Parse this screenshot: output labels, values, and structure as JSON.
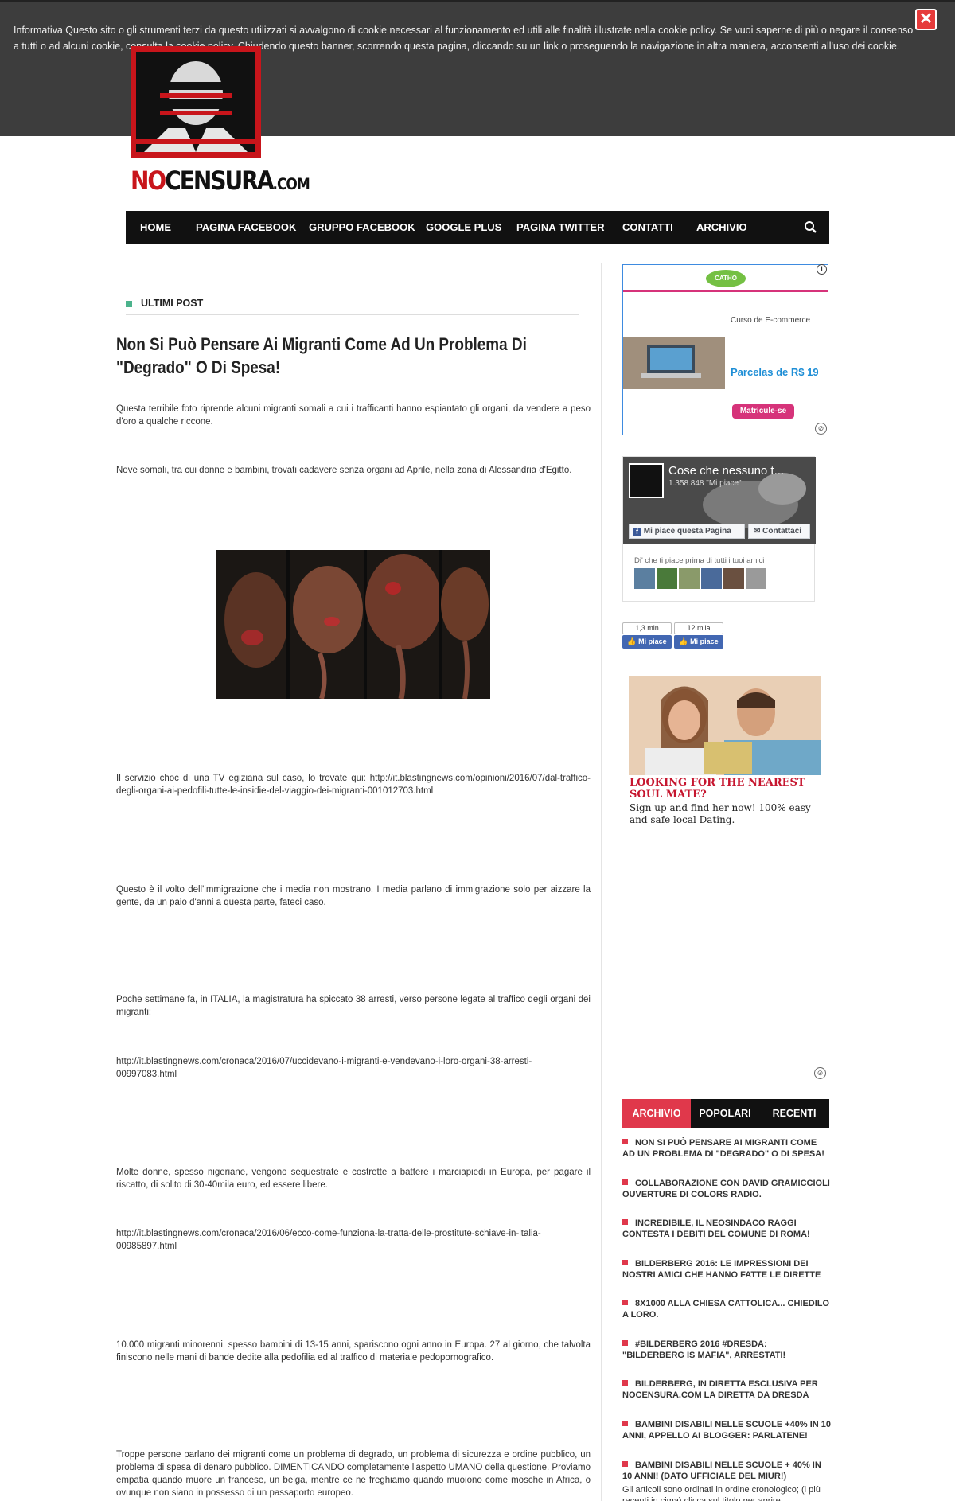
{
  "cookie_banner": {
    "text": "Informativa Questo sito o gli strumenti terzi da questo utilizzati si avvalgono di cookie necessari al funzionamento ed utili alle finalità illustrate nella cookie policy. Se vuoi saperne di più o negare il consenso a tutti o ad alcuni cookie, consulta la cookie policy. Chiudendo questo banner, scorrendo questa pagina, cliccando su un link o proseguendo la navigazione in altra maniera, acconsenti all'uso dei cookie.",
    "close_label": "✕"
  },
  "header": {
    "logo_no": "NO",
    "logo_censura": "CENSURA",
    "logo_com": ".COM"
  },
  "nav": {
    "items": [
      "HOME",
      "PAGINA FACEBOOK",
      "GRUPPO FACEBOOK",
      "GOOGLE PLUS",
      "PAGINA TWITTER",
      "CONTATTI",
      "ARCHIVIO"
    ],
    "search_icon": "search-icon"
  },
  "main": {
    "section_label": "ULTIMI POST",
    "title": "Non Si Può Pensare Ai Migranti Come Ad Un Problema Di \"Degrado\" O Di Spesa!",
    "paragraphs": [
      "Questa terribile foto riprende alcuni migranti somali a cui i trafficanti hanno espiantato gli organi, da vendere a peso d'oro a qualche riccone.",
      "Nove somali,  tra cui donne e bambini, trovati cadavere senza organi ad Aprile, nella zona di Alessandria d'Egitto.",
      "Il servizio choc di una TV egiziana sul caso, lo trovate qui: http://it.blastingnews.com/opinioni/2016/07/dal-traffico-degli-organi-ai-pedofili-tutte-le-insidie-del-viaggio-dei-migranti-001012703.html",
      "Questo è il volto dell'immigrazione che i media non mostrano. I media parlano di immigrazione solo per aizzare la gente, da un paio d'anni a questa parte, fateci caso.",
      "Poche settimane fa, in ITALIA, la magistratura ha spiccato 38 arresti, verso persone legate al traffico degli organi dei migranti:",
      "http://it.blastingnews.com/cronaca/2016/07/uccidevano-i-migranti-e-vendevano-i-loro-organi-38-arresti-00997083.html",
      "Molte donne, spesso nigeriane, vengono sequestrate e costrette a battere i marciapiedi in Europa, per pagare il riscatto, di solito di 30-40mila euro, ed essere libere.",
      "http://it.blastingnews.com/cronaca/2016/06/ecco-come-funziona-la-tratta-delle-prostitute-schiave-in-italia-00985897.html",
      "10.000 migranti minorenni, spesso bambini di 13-15 anni, spariscono ogni anno in Europa. 27 al giorno, che talvolta finiscono nelle mani di bande dedite alla pedofilia ed al traffico di materiale pedopornografico.",
      "Troppe persone parlano dei migranti come un problema di degrado, un problema di sicurezza e ordine pubblico, un problema di spesa di denaro pubblico. DIMENTICANDO completamente l'aspetto UMANO della questione. Proviamo empatia quando muore un francese, un belga, mentre ce ne freghiamo quando muoiono come mosche in Africa, o ovunque non siano in possesso di un passaporto europeo."
    ]
  },
  "sidebar": {
    "ad1": {
      "brand": "CATHO",
      "course": "Curso de E-commerce",
      "price": "Parcelas de R$ 19",
      "cta": "Matricule-se"
    },
    "fb": {
      "page_name": "Cose che nessuno t...",
      "likes": "1.358.848 \"Mi piace\"",
      "like_button": "Mi piace questa Pagina",
      "contact_button": "Contattaci",
      "friends_text": "Di' che ti piace prima di tutti i tuoi amici"
    },
    "like_widgets": [
      {
        "count": "1,3 mln",
        "label": "Mi piace"
      },
      {
        "count": "12 mila",
        "label": "Mi piace"
      }
    ],
    "ad2": {
      "title": "LOOKING FOR THE NEAREST SOUL MATE?",
      "text": "Sign up and find her now! 100% easy and safe local Dating."
    },
    "tabs": [
      "ARCHIVIO",
      "POPOLARI",
      "RECENTI"
    ],
    "archive": [
      "NON SI PUÒ PENSARE AI MIGRANTI COME AD UN PROBLEMA DI \"DEGRADO\" O DI SPESA!",
      "COLLABORAZIONE CON DAVID GRAMICCIOLI OUVERTURE DI COLORS RADIO.",
      "INCREDIBILE, IL NEOSINDACO RAGGI CONTESTA I DEBITI DEL COMUNE DI ROMA!",
      "BILDERBERG 2016: LE IMPRESSIONI DEI NOSTRI AMICI CHE HANNO FATTE LE DIRETTE",
      "8X1000 ALLA CHIESA CATTOLICA... CHIEDILO A LORO.",
      "#BILDERBERG 2016 #DRESDA: \"BILDERBERG IS MAFIA\", ARRESTATI!",
      "BILDERBERG, IN DIRETTA ESCLUSIVA PER NOCENSURA.COM LA DIRETTA DA DRESDA",
      "BAMBINI DISABILI NELLE SCUOLE +40% IN 10 ANNI, APPELLO AI BLOGGER: PARLATENE!",
      "BAMBINI DISABILI NELLE SCUOLE + 40% IN 10 ANNI! (DATO UFFICIALE DEL MIUR!)"
    ],
    "archive_note": "Gli articoli sono ordinati in ordine cronologico; (i più recenti in cima) clicca sul titolo per aprire"
  }
}
